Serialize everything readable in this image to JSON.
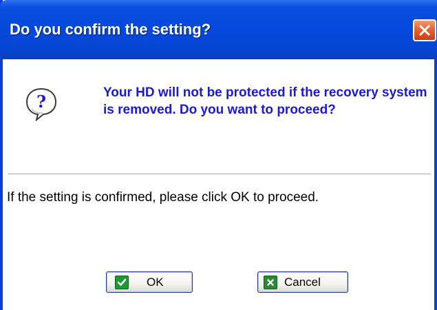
{
  "dialog": {
    "title": "Do you confirm the setting?",
    "message": "Your HD will not be protected if the recovery system is removed. Do you want to proceed?",
    "instruction": "If the setting is confirmed, please click OK to proceed.",
    "icon": "question-bubble-icon",
    "message_color": "#1a1ad6",
    "titlebar_color": "#0448dc"
  },
  "buttons": {
    "ok_label": "OK",
    "ok_icon": "green-check-icon",
    "cancel_label": "Cancel",
    "cancel_icon": "green-x-icon",
    "close_icon": "close-x-icon"
  }
}
